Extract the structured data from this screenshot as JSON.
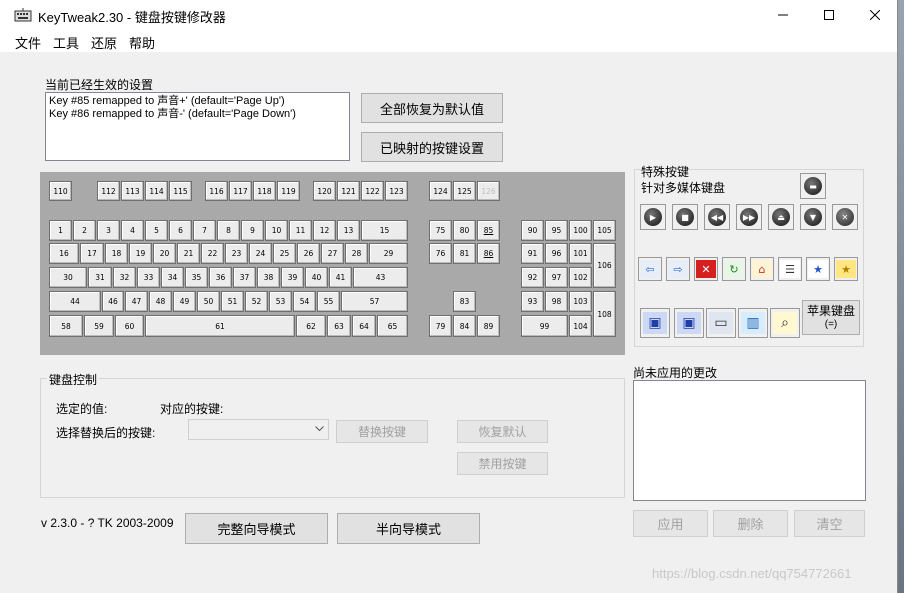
{
  "window": {
    "title": "KeyTweak2.30 -  键盘按键修改器"
  },
  "menu": [
    "文件",
    "工具",
    "还原",
    "帮助"
  ],
  "current": {
    "label": "当前已经生效的设置",
    "lines": [
      "Key #85 remapped to 声音+' (default='Page Up')",
      "Key #86 remapped to 声音-' (default='Page Down')"
    ]
  },
  "buttons": {
    "restore_all": "全部恢复为默认值",
    "show_mapped": "已映射的按键设置",
    "replace": "替换按键",
    "restore_default": "恢复默认",
    "disable": "禁用按键",
    "full_mode": "完整向导模式",
    "half_mode": "半向导模式",
    "apply": "应用",
    "remove": "删除",
    "clear": "清空",
    "apple": "苹果键盘",
    "apple_sub": "(=)"
  },
  "special": {
    "label1": "特殊按键",
    "label2": "针对多媒体键盘"
  },
  "control": {
    "legend": "键盘控制",
    "selected_value": "选定的值:",
    "mapped_key": "对应的按键:",
    "choose_label": "选择替换后的按键:"
  },
  "pending": {
    "label": "尚未应用的更改"
  },
  "version": "v 2.3.0 - ? TK 2003-2009",
  "watermark": "https://blog.csdn.net/qq754772661",
  "keys": [
    [
      "110"
    ],
    [
      "112"
    ],
    [
      "113"
    ],
    [
      "114"
    ],
    [
      "115"
    ],
    [
      "116"
    ],
    [
      "117"
    ],
    [
      "118"
    ],
    [
      "119"
    ],
    [
      "120"
    ],
    [
      "121"
    ],
    [
      "122"
    ],
    [
      "123"
    ],
    [
      "124"
    ],
    [
      "125"
    ],
    [
      "126"
    ],
    [
      "1"
    ],
    [
      "2"
    ],
    [
      "3"
    ],
    [
      "4"
    ],
    [
      "5"
    ],
    [
      "6"
    ],
    [
      "7"
    ],
    [
      "8"
    ],
    [
      "9"
    ],
    [
      "10"
    ],
    [
      "11"
    ],
    [
      "12"
    ],
    [
      "13"
    ],
    [
      "15"
    ],
    [
      "16"
    ],
    [
      "17"
    ],
    [
      "18"
    ],
    [
      "19"
    ],
    [
      "20"
    ],
    [
      "21"
    ],
    [
      "22"
    ],
    [
      "23"
    ],
    [
      "24"
    ],
    [
      "25"
    ],
    [
      "26"
    ],
    [
      "27"
    ],
    [
      "28"
    ],
    [
      "29"
    ],
    [
      "30"
    ],
    [
      "31"
    ],
    [
      "32"
    ],
    [
      "33"
    ],
    [
      "34"
    ],
    [
      "35"
    ],
    [
      "36"
    ],
    [
      "37"
    ],
    [
      "38"
    ],
    [
      "39"
    ],
    [
      "40"
    ],
    [
      "41"
    ],
    [
      "43"
    ],
    [
      "44"
    ],
    [
      "46"
    ],
    [
      "47"
    ],
    [
      "48"
    ],
    [
      "49"
    ],
    [
      "50"
    ],
    [
      "51"
    ],
    [
      "52"
    ],
    [
      "53"
    ],
    [
      "54"
    ],
    [
      "55"
    ],
    [
      "57"
    ],
    [
      "58"
    ],
    [
      "59"
    ],
    [
      "60"
    ],
    [
      "61"
    ],
    [
      "62"
    ],
    [
      "63"
    ],
    [
      "64"
    ],
    [
      "65"
    ],
    [
      "75"
    ],
    [
      "80"
    ],
    [
      "85"
    ],
    [
      "76"
    ],
    [
      "81"
    ],
    [
      "86"
    ],
    [
      "83"
    ],
    [
      "79"
    ],
    [
      "84"
    ],
    [
      "89"
    ],
    [
      "90"
    ],
    [
      "95"
    ],
    [
      "100"
    ],
    [
      "105"
    ],
    [
      "91"
    ],
    [
      "96"
    ],
    [
      "101"
    ],
    [
      "106"
    ],
    [
      "92"
    ],
    [
      "97"
    ],
    [
      "102"
    ],
    [
      "93"
    ],
    [
      "98"
    ],
    [
      "103"
    ],
    [
      "108"
    ],
    [
      "99"
    ],
    [
      "104"
    ]
  ],
  "icons": [
    "play-icon",
    "stop-icon",
    "rewind-icon",
    "forward-icon",
    "eject-icon",
    "volume-down-icon",
    "mute-icon",
    "sleep-icon",
    "back-icon",
    "forward-nav-icon",
    "stop-web-icon",
    "refresh-icon",
    "home-icon",
    "search-web-icon",
    "favorites-icon",
    "media-icon",
    "mail-icon",
    "my-computer-icon",
    "computer-icon",
    "calculator-icon",
    "search-icon"
  ]
}
